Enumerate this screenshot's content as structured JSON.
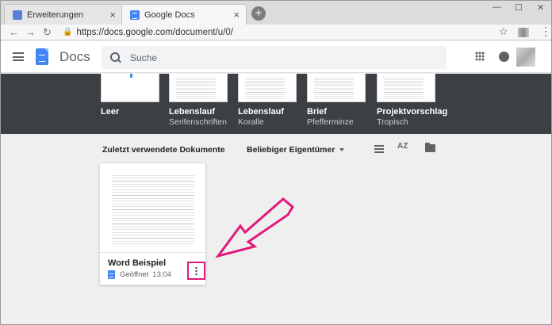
{
  "browser": {
    "tabs": [
      {
        "label": "Erweiterungen",
        "active": false,
        "icon": "puzzle-icon"
      },
      {
        "label": "Google Docs",
        "active": true,
        "icon": "docs-icon"
      }
    ],
    "url": "https://docs.google.com/document/u/0/",
    "close_glyph": "×",
    "newtab_glyph": "+",
    "back_glyph": "←",
    "forward_glyph": "→",
    "reload_glyph": "↻",
    "star_glyph": "☆",
    "menu_glyph": "⋮",
    "minimize_glyph": "—",
    "maximize_glyph": "☐",
    "closewin_glyph": "✕"
  },
  "app": {
    "brand": "Docs",
    "search": {
      "placeholder": "Suche"
    }
  },
  "templates": [
    {
      "name": "Leer",
      "sub": ""
    },
    {
      "name": "Lebenslauf",
      "sub": "Serifenschriften"
    },
    {
      "name": "Lebenslauf",
      "sub": "Koralle"
    },
    {
      "name": "Brief",
      "sub": "Pfefferminze"
    },
    {
      "name": "Projektvorschlag",
      "sub": "Tropisch"
    }
  ],
  "recent": {
    "section_title": "Zuletzt verwendete Dokumente",
    "owner_filter": "Beliebiger Eigentümer",
    "sort_label": "AZ",
    "documents": [
      {
        "title": "Word Beispiel",
        "status": "Geöffnet",
        "time": "13:04"
      }
    ]
  },
  "colors": {
    "accent": "#4285f4",
    "highlight": "#e0197d",
    "gallery_bg": "#3c3f43"
  }
}
